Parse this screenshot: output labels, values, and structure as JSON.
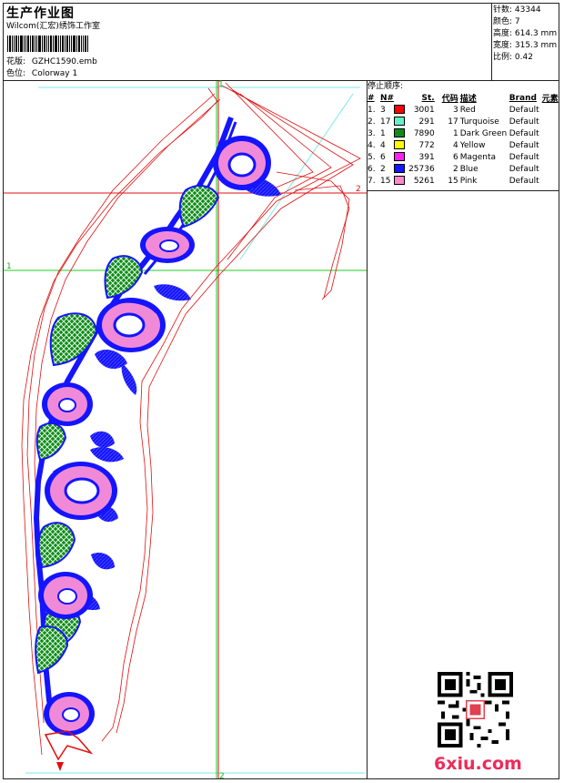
{
  "header": {
    "title": "生产作业图",
    "studio": "Wilcom(汇宏)绣饰工作室",
    "design_file_label": "花版:",
    "design_file": "GZHC1590.emb",
    "colorway_label": "色位:",
    "colorway": "Colorway 1"
  },
  "info": {
    "stitches_label": "针数:",
    "stitches": "43344",
    "colors_label": "颜色:",
    "colors": "7",
    "height_label": "高度:",
    "height": "614.3 mm",
    "width_label": "宽度:",
    "width": "315.3 mm",
    "scale_label": "比例:",
    "scale": "0.42"
  },
  "stop_sequence": {
    "title": "停止顺序:",
    "headers": {
      "num": "#",
      "n": "N#",
      "st": "St.",
      "code": "代码",
      "desc": "描述",
      "brand": "Brand",
      "elem": "元素"
    },
    "rows": [
      {
        "num": "1.",
        "n": "3",
        "color": "#ff0000",
        "st": "3001",
        "code": "3",
        "desc": "Red",
        "brand": "Default"
      },
      {
        "num": "2.",
        "n": "17",
        "color": "#66f0c8",
        "st": "291",
        "code": "17",
        "desc": "Turquoise",
        "brand": "Default"
      },
      {
        "num": "3.",
        "n": "1",
        "color": "#0f8c1a",
        "st": "7890",
        "code": "1",
        "desc": "Dark Green",
        "brand": "Default"
      },
      {
        "num": "4.",
        "n": "4",
        "color": "#ffff00",
        "st": "772",
        "code": "4",
        "desc": "Yellow",
        "brand": "Default"
      },
      {
        "num": "5.",
        "n": "6",
        "color": "#ff22ee",
        "st": "391",
        "code": "6",
        "desc": "Magenta",
        "brand": "Default"
      },
      {
        "num": "6.",
        "n": "2",
        "color": "#1414ff",
        "st": "25736",
        "code": "2",
        "desc": "Blue",
        "brand": "Default"
      },
      {
        "num": "7.",
        "n": "15",
        "color": "#ff88cc",
        "st": "5261",
        "code": "15",
        "desc": "Pink",
        "brand": "Default"
      }
    ]
  },
  "guides": {
    "top": "1",
    "bottom": "2",
    "left": "1",
    "right": "2"
  },
  "watermark": {
    "logo": "6xiu.com"
  },
  "palette": {
    "red": "#e01010",
    "green_guide": "#22cc22",
    "blue": "#1414ff",
    "pink": "#f08ad8",
    "dark_green": "#0f8c1a",
    "cyan": "#66e0e0"
  }
}
